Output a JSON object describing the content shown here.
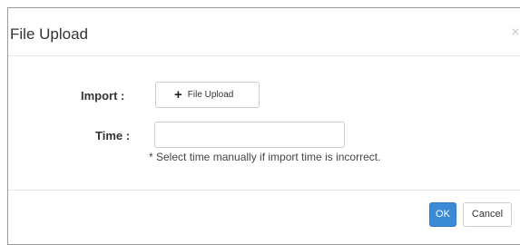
{
  "dialog": {
    "title": "File Upload",
    "close_label": "×"
  },
  "form": {
    "import_label": "Import :",
    "upload_button_label": "File Upload",
    "upload_icon": "plus-icon",
    "time_label": "Time :",
    "time_value": "",
    "time_placeholder": "",
    "help_text": "* Select time manually if import time is incorrect."
  },
  "footer": {
    "ok_label": "OK",
    "cancel_label": "Cancel"
  },
  "colors": {
    "primary": "#3a8ad6",
    "border": "#cccccc"
  }
}
